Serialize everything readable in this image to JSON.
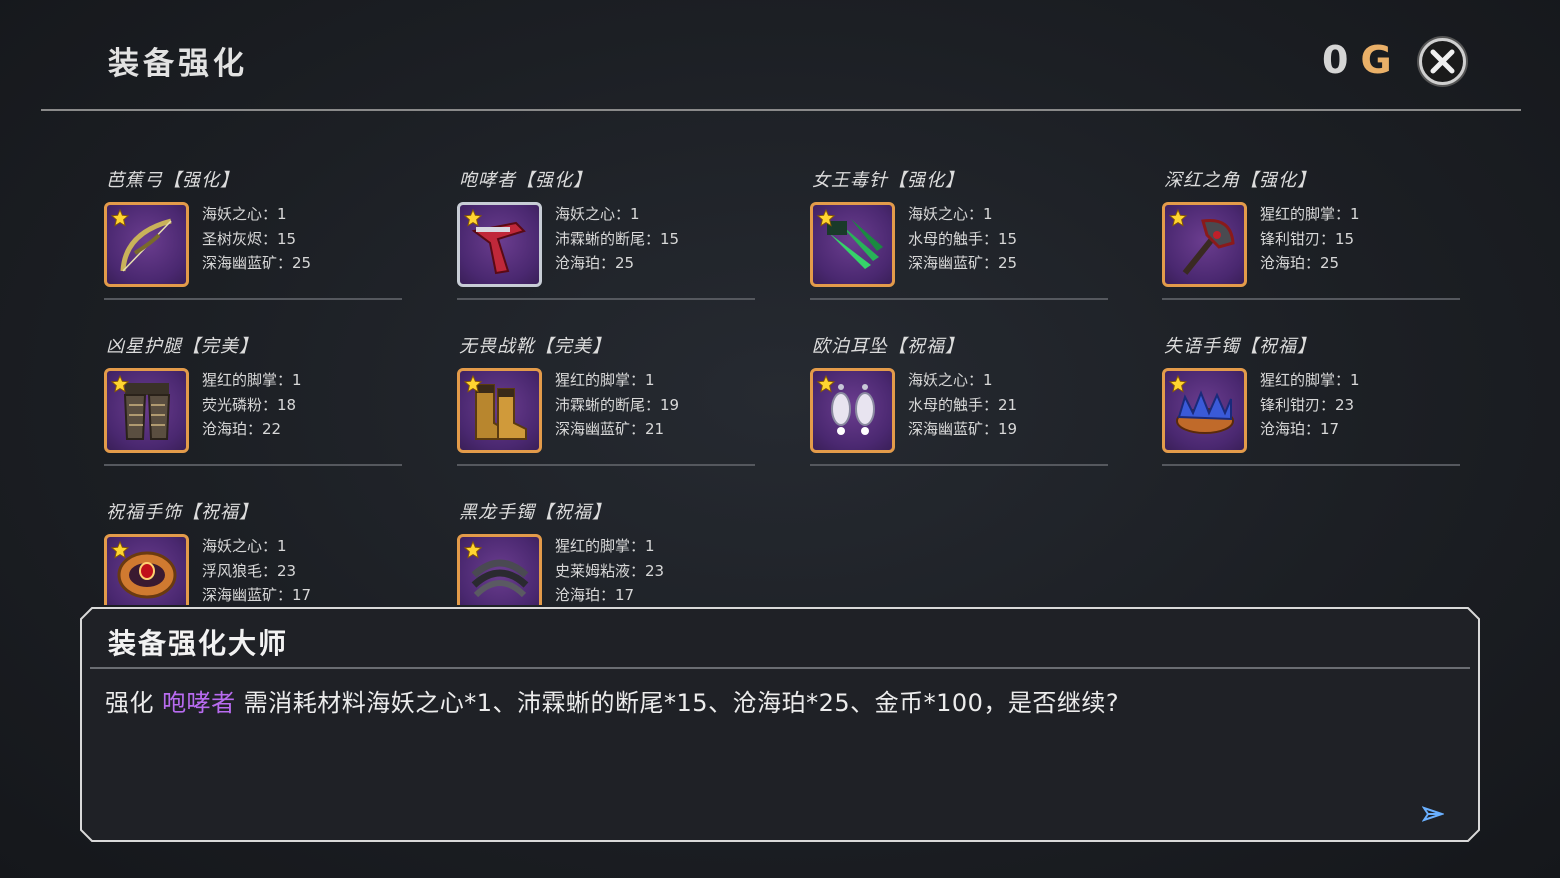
{
  "header": {
    "title": "装备强化",
    "gold_amount": "0",
    "gold_unit": "G"
  },
  "items": [
    {
      "name": "芭蕉弓【强化】",
      "icon": "bow-icon",
      "mats": [
        "海妖之心：1",
        "圣树灰烬：15",
        "深海幽蓝矿：25"
      ]
    },
    {
      "name": "咆哮者【强化】",
      "icon": "pistol-icon",
      "mats": [
        "海妖之心：1",
        "沛霖蜥的断尾：15",
        "沧海珀：25"
      ]
    },
    {
      "name": "女王毒针【强化】",
      "icon": "claws-icon",
      "mats": [
        "海妖之心：1",
        "水母的触手：15",
        "深海幽蓝矿：25"
      ]
    },
    {
      "name": "深红之角【强化】",
      "icon": "axe-icon",
      "mats": [
        "猩红的脚掌：1",
        "锋利钳刃：15",
        "沧海珀：25"
      ]
    },
    {
      "name": "凶星护腿【完美】",
      "icon": "leggings-icon",
      "mats": [
        "猩红的脚掌：1",
        "荧光磷粉：18",
        "沧海珀：22"
      ]
    },
    {
      "name": "无畏战靴【完美】",
      "icon": "boots-icon",
      "mats": [
        "猩红的脚掌：1",
        "沛霖蜥的断尾：19",
        "深海幽蓝矿：21"
      ]
    },
    {
      "name": "欧泊耳坠【祝福】",
      "icon": "earrings-icon",
      "mats": [
        "海妖之心：1",
        "水母的触手：21",
        "深海幽蓝矿：19"
      ]
    },
    {
      "name": "失语手镯【祝福】",
      "icon": "crown-bracelet-icon",
      "mats": [
        "猩红的脚掌：1",
        "锋利钳刃：23",
        "沧海珀：17"
      ]
    },
    {
      "name": "祝福手饰【祝福】",
      "icon": "ruby-bracelet-icon",
      "mats": [
        "海妖之心：1",
        "浮风狼毛：23",
        "深海幽蓝矿：17"
      ]
    },
    {
      "name": "黑龙手镯【祝福】",
      "icon": "dragon-bracelet-icon",
      "mats": [
        "猩红的脚掌：1",
        "史莱姆粘液：23",
        "沧海珀：17"
      ]
    }
  ],
  "dialog": {
    "speaker": "装备强化大师",
    "msg_prefix": "强化 ",
    "msg_item": "咆哮者",
    "msg_suffix": " 需消耗材料海妖之心*1、沛霖蜥的断尾*15、沧海珀*25、金币*100，是否继续?"
  },
  "colors": {
    "gold_unit": "#eab068",
    "highlight": "#b86bf0",
    "icon_border": "#e39b4a",
    "icon_bg": "#4a2870"
  }
}
